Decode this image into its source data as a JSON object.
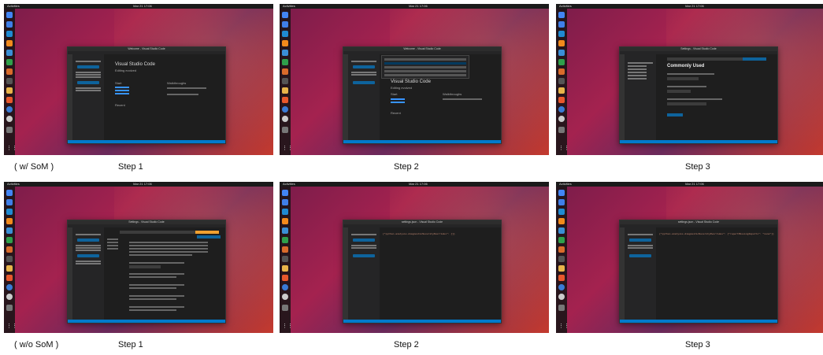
{
  "side_labels": {
    "top": "( w/ SoM )",
    "bottom": "( w/o SoM )"
  },
  "step_labels": [
    "Step 1",
    "Step 2",
    "Step 3"
  ],
  "desktop": {
    "activities": "Activities",
    "app_name": "Visual Studio Code",
    "clock": "Mar 21 17:06"
  },
  "screens": [
    {
      "title": "Welcome - Visual Studio Code",
      "heading": "Visual Studio Code",
      "subheading": "Editing evolved"
    },
    {
      "title": "Welcome - Visual Studio Code",
      "heading": "Visual Studio Code",
      "subheading": "Editing evolved"
    },
    {
      "title": "Settings - Visual Studio Code",
      "heading": "Commonly Used",
      "subheading": ""
    },
    {
      "title": "Settings - Visual Studio Code",
      "heading": "",
      "subheading": ""
    },
    {
      "title": "settings.json - Visual Studio Code",
      "heading": "",
      "subheading": ""
    },
    {
      "title": "settings.json - Visual Studio Code",
      "heading": "",
      "subheading": ""
    }
  ],
  "welcome": {
    "start": "Start",
    "walkthroughs": "Walkthroughs",
    "recent": "Recent"
  },
  "code_snippets": {
    "step2": "{\"python.analysis.diagnosticSeverityOverrides\": {}}",
    "step3": "{\"python.analysis.diagnosticSeverityOverrides\": {\"reportMissingImports\": \"none\"}}"
  }
}
